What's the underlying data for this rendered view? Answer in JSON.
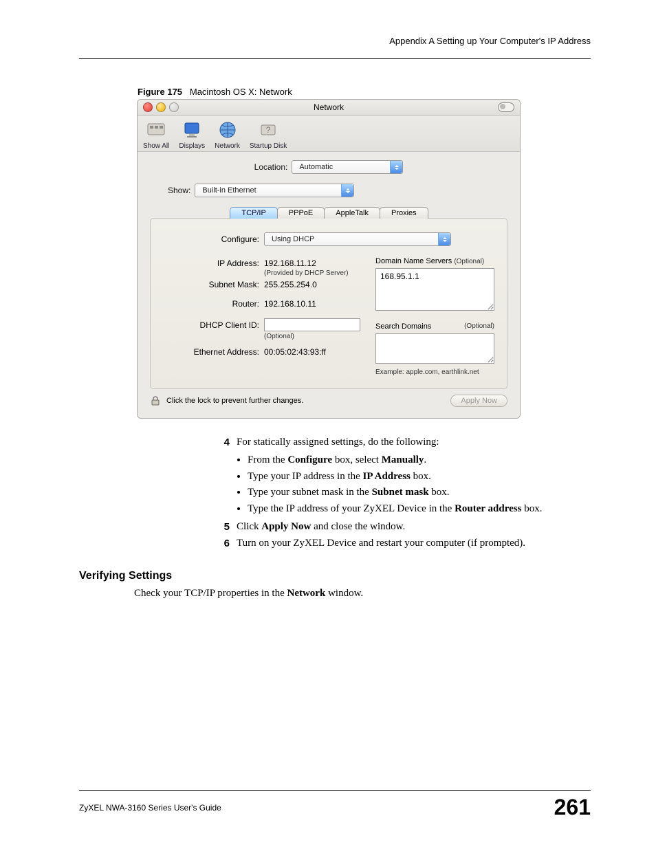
{
  "header": {
    "appendix": "Appendix A Setting up Your Computer's IP Address"
  },
  "figure": {
    "number": "Figure 175",
    "caption": "Macintosh OS X: Network"
  },
  "window": {
    "title": "Network",
    "toolbar": [
      {
        "id": "show-all",
        "label": "Show All"
      },
      {
        "id": "displays",
        "label": "Displays"
      },
      {
        "id": "network",
        "label": "Network"
      },
      {
        "id": "startup-disk",
        "label": "Startup Disk"
      }
    ],
    "location": {
      "label": "Location:",
      "value": "Automatic"
    },
    "show": {
      "label": "Show:",
      "value": "Built-in Ethernet"
    },
    "tabs": [
      {
        "id": "tcpip",
        "label": "TCP/IP",
        "active": true
      },
      {
        "id": "pppoe",
        "label": "PPPoE",
        "active": false
      },
      {
        "id": "appletalk",
        "label": "AppleTalk",
        "active": false
      },
      {
        "id": "proxies",
        "label": "Proxies",
        "active": false
      }
    ],
    "configure": {
      "label": "Configure:",
      "value": "Using DHCP"
    },
    "ip": {
      "label": "IP Address:",
      "value": "192.168.11.12",
      "note": "(Provided by DHCP Server)"
    },
    "subnet": {
      "label": "Subnet Mask:",
      "value": "255.255.254.0"
    },
    "router": {
      "label": "Router:",
      "value": "192.168.10.11"
    },
    "dhcp_client": {
      "label": "DHCP Client ID:",
      "note": "(Optional)"
    },
    "ether": {
      "label": "Ethernet Address:",
      "value": "00:05:02:43:93:ff"
    },
    "dns": {
      "label": "Domain Name Servers",
      "optional": "(Optional)",
      "value": "168.95.1.1"
    },
    "search": {
      "label": "Search Domains",
      "optional": "(Optional)",
      "example": "Example: apple.com, earthlink.net"
    },
    "lock_text": "Click the lock to prevent further changes.",
    "apply": "Apply Now"
  },
  "steps": {
    "s4": "For statically assigned settings, do the following:",
    "s4_bullets": [
      {
        "pre": "From the ",
        "b": "Configure",
        "mid": " box, select ",
        "b2": "Manually",
        "post": "."
      },
      {
        "pre": "Type your IP address in the ",
        "b": "IP Address",
        "post": " box."
      },
      {
        "pre": "Type your subnet mask in the ",
        "b": "Subnet mask",
        "post": " box."
      },
      {
        "pre": "Type the IP address of your ZyXEL Device in the ",
        "b": "Router address",
        "post": " box."
      }
    ],
    "s5_pre": "Click ",
    "s5_b": "Apply Now",
    "s5_post": " and close the window.",
    "s6": "Turn on your ZyXEL Device and restart your computer (if prompted)."
  },
  "verify": {
    "heading": "Verifying Settings",
    "text_pre": "Check your TCP/IP properties in the ",
    "text_b": "Network",
    "text_post": " window."
  },
  "footer": {
    "guide": "ZyXEL NWA-3160 Series User's Guide",
    "page": "261"
  }
}
